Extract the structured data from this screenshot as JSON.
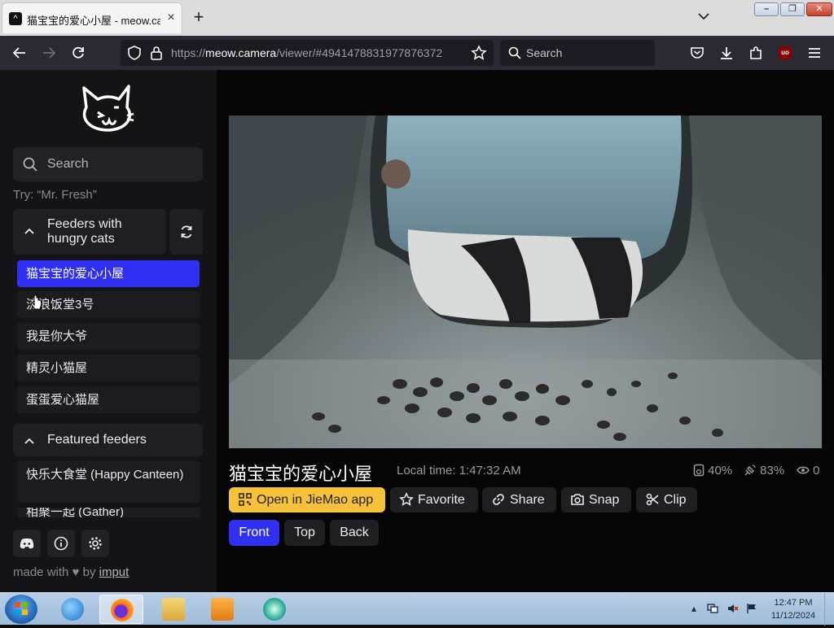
{
  "browser": {
    "tab_title": "猫宝宝的爱心小屋 - meow.camera",
    "tab_close": "×",
    "new_tab": "+",
    "tab_list": "⌄",
    "url_scheme": "https://",
    "url_host": "meow.camera",
    "url_path": "/viewer/#4941478831977876372",
    "search_placeholder": "Search"
  },
  "sidebar": {
    "search_placeholder": "Search",
    "try_hint": "Try: “Mr. Fresh”",
    "section1_title": "Feeders with hungry cats",
    "feeders": [
      {
        "name": "猫宝宝的爱心小屋",
        "active": true
      },
      {
        "name": "流浪饭堂3号",
        "active": false
      },
      {
        "name": "我是你大爷",
        "active": false
      },
      {
        "name": "精灵小猫屋",
        "active": false
      },
      {
        "name": "蛋蛋爱心猫屋",
        "active": false
      }
    ],
    "section2_title": "Featured feeders",
    "featured": [
      {
        "name": "快乐大食堂 (Happy Canteen)"
      },
      {
        "name": "相聚一起 (Gather)"
      }
    ],
    "made_with": "made with",
    "heart": "♥",
    "by": "by",
    "author": "imput"
  },
  "camera": {
    "title": "猫宝宝的爱心小屋",
    "local_time": "Local time: 1:47:32 AM",
    "food_level": "40%",
    "signal": "83%",
    "viewers": "0",
    "buttons": {
      "open_app": "Open in JieMao app",
      "favorite": "Favorite",
      "share": "Share",
      "snap": "Snap",
      "clip": "Clip"
    },
    "views": {
      "front": "Front",
      "top": "Top",
      "back": "Back"
    }
  },
  "taskbar": {
    "time": "12:47 PM",
    "date": "11/12/2024"
  },
  "colors": {
    "accent": "#3030f5",
    "app_button": "#f6c23a",
    "sidebar_bg": "#141416",
    "main_bg": "#060606"
  }
}
